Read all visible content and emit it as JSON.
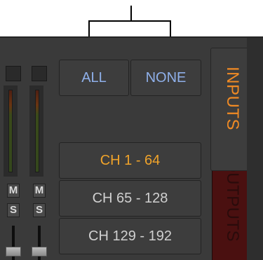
{
  "selection_buttons": {
    "all_label": "ALL",
    "none_label": "NONE"
  },
  "channel_banks": [
    {
      "label": "CH 1 - 64",
      "active": true
    },
    {
      "label": "CH 65 - 128",
      "active": false
    },
    {
      "label": "CH 129 - 192",
      "active": false
    }
  ],
  "tabs": {
    "inputs_label": "INPUTS",
    "outputs_label": "OUTPUTS",
    "selected": "INPUTS"
  },
  "mixer_strips": {
    "mute_label": "M",
    "solo_label": "S"
  },
  "colors": {
    "active_text": "#f0a32a",
    "button_text": "#8fb0ea",
    "inputs_tab_text": "#f08a24",
    "outputs_tab_bg": "#4a1010"
  }
}
